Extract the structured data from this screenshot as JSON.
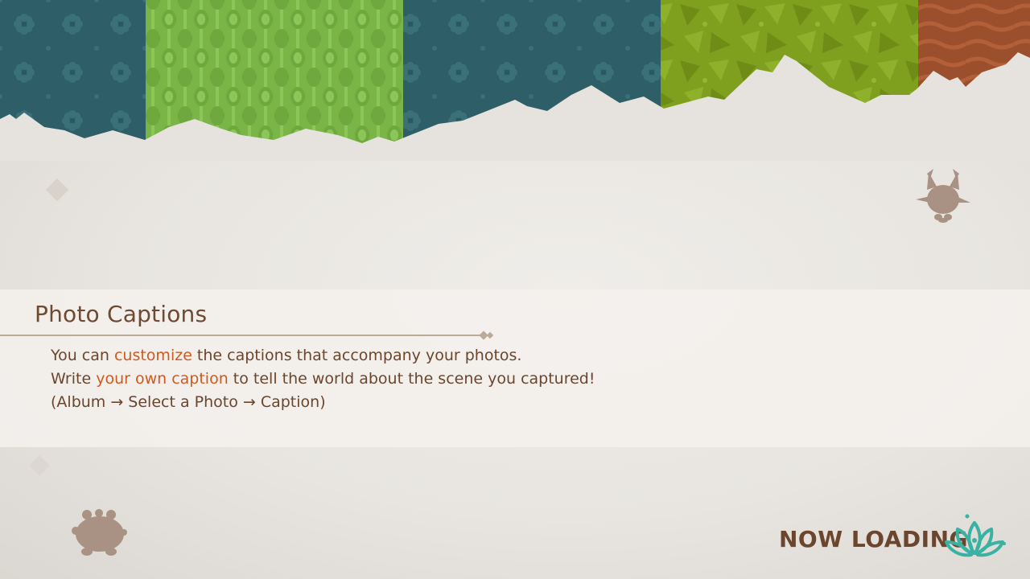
{
  "tip": {
    "title": "Photo Captions",
    "line1_pre": "You can ",
    "line1_hl": "customize",
    "line1_post": " the captions that accompany your photos.",
    "line2_pre": "Write ",
    "line2_hl": "your own caption",
    "line2_post": " to tell the world about the scene you captured!",
    "line3": "(Album → Select a Photo → Caption)"
  },
  "loading": {
    "label": "NOW LOADING",
    "icon": "lotus-icon"
  },
  "decor": {
    "creature_right_icon": "creature-silhouette-icon",
    "creature_left_icon": "creature-silhouette-icon"
  },
  "colors": {
    "banner_teal": "#2e5f68",
    "banner_green": "#7fb84a",
    "banner_olive": "#7f9f1f",
    "banner_rust": "#9c4f2d",
    "text_brown": "#6b452e",
    "highlight_orange": "#cf5a1f",
    "icon_teal": "#3ab2a3",
    "silhouette": "#a99283"
  }
}
